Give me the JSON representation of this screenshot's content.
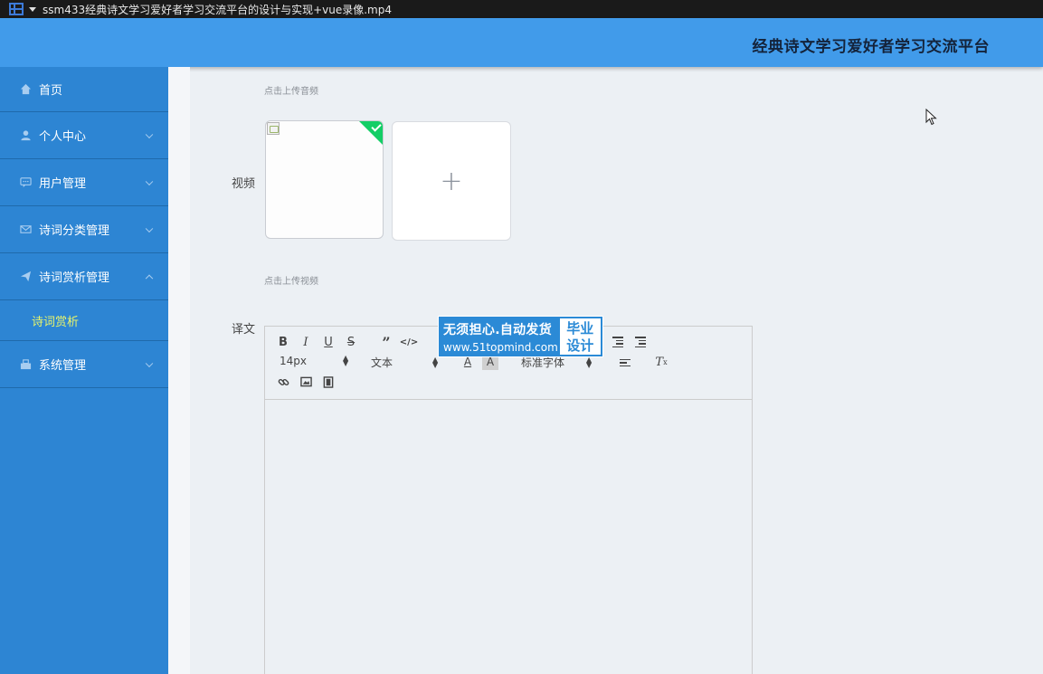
{
  "player": {
    "filename": "ssm433经典诗文学习爱好者学习交流平台的设计与实现+vue录像.mp4"
  },
  "header": {
    "title": "经典诗文学习爱好者学习交流平台"
  },
  "sidebar": {
    "items": [
      {
        "label": "首页",
        "icon": "home-icon"
      },
      {
        "label": "个人中心",
        "icon": "user-icon"
      },
      {
        "label": "用户管理",
        "icon": "chat-icon"
      },
      {
        "label": "诗词分类管理",
        "icon": "mail-icon"
      },
      {
        "label": "诗词赏析管理",
        "icon": "send-icon"
      },
      {
        "label": "系统管理",
        "icon": "office-icon"
      }
    ],
    "subitems": [
      {
        "label": "诗词赏析"
      }
    ]
  },
  "form": {
    "audio_hint": "点击上传音频",
    "video_label": "视频",
    "video_hint": "点击上传视频",
    "translation_label": "译文"
  },
  "editor": {
    "font_size": "14px",
    "header_select": "文本",
    "font_family": "标准字体"
  },
  "watermark": {
    "line1": "无须担心.自动发货",
    "line2": "www.51topmind.com",
    "badge_line1": "毕业",
    "badge_line2": "设计"
  },
  "colors": {
    "header": "#419bea",
    "sidebar": "#2d85d3",
    "active_submenu": "#e9f56a",
    "success": "#13ce66"
  }
}
